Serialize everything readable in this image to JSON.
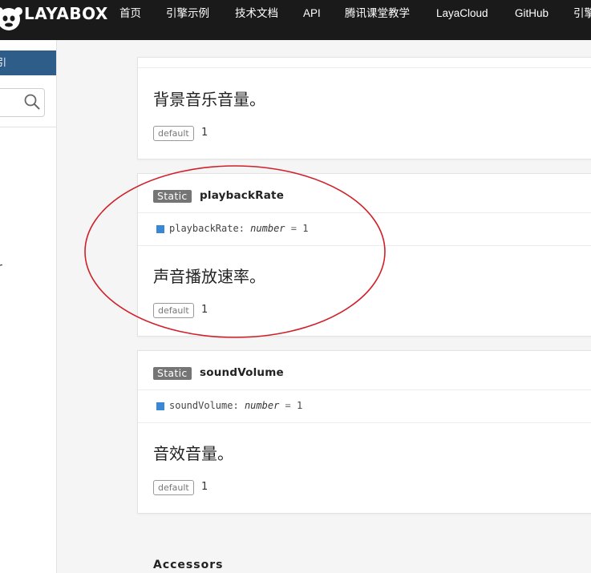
{
  "header": {
    "logo_text": "LAYABOX",
    "nav": [
      {
        "label": "首页"
      },
      {
        "label": "引擎示例"
      },
      {
        "label": "技术文档"
      },
      {
        "label": "API"
      },
      {
        "label": "腾讯课堂教学"
      },
      {
        "label": "LayaCloud"
      },
      {
        "label": "GitHub"
      },
      {
        "label": "引擎"
      }
    ]
  },
  "sidebar": {
    "header_text": "引",
    "fragment_text": "r"
  },
  "cards": [
    {
      "description": "背景音乐音量。",
      "default_label": "default",
      "default_value": "1"
    },
    {
      "badge": "Static",
      "name": "playbackRate",
      "sig_name": "playbackRate",
      "sig_colon": ":",
      "sig_type": "number",
      "sig_eq": "=",
      "sig_value": "1",
      "description": "声音播放速率。",
      "default_label": "default",
      "default_value": "1"
    },
    {
      "badge": "Static",
      "name": "soundVolume",
      "sig_name": "soundVolume",
      "sig_colon": ":",
      "sig_type": "number",
      "sig_eq": "=",
      "sig_value": "1",
      "description": "音效音量。",
      "default_label": "default",
      "default_value": "1"
    }
  ],
  "section": {
    "title": "Accessors"
  },
  "colors": {
    "navbar_bg": "#1a1a1a",
    "sidebar_head_bg": "#2f5d8a",
    "badge_bg": "#757575",
    "sig_square": "#3a87d6",
    "annotation": "#d0202a"
  },
  "icons": {
    "logo": "laya-monkey-icon",
    "search": "search-icon"
  }
}
